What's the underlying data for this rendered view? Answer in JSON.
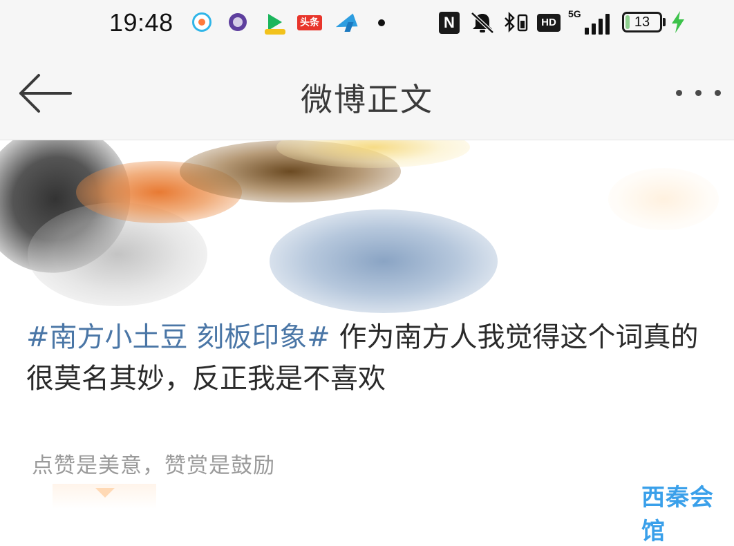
{
  "status_bar": {
    "time": "19:48",
    "notification_app_icons": [
      "news-app-icon",
      "browser-app-icon",
      "video-app-icon",
      "toutiao-app-icon",
      "telegram-app-icon"
    ],
    "toutiao_label": "头条",
    "nfc_label": "N",
    "hd_label": "HD",
    "network_type": "5G",
    "battery_level": "13",
    "battery_fraction": 0.13,
    "charging": true
  },
  "nav": {
    "title": "微博正文"
  },
  "post": {
    "topic": "#南方小土豆 刻板印象#",
    "text": " 作为南方人我觉得这个词真的很莫名其妙，反正我是不喜欢"
  },
  "reward": {
    "prompt": "点赞是美意，赞赏是鼓励"
  },
  "watermark": {
    "text": "西秦会馆"
  },
  "colors": {
    "topic_link": "#4a76a6",
    "body_text": "#2a2a2a",
    "muted_text": "#9a9a9a",
    "bar_background": "#f6f6f6",
    "watermark": "#3aa0ea"
  }
}
